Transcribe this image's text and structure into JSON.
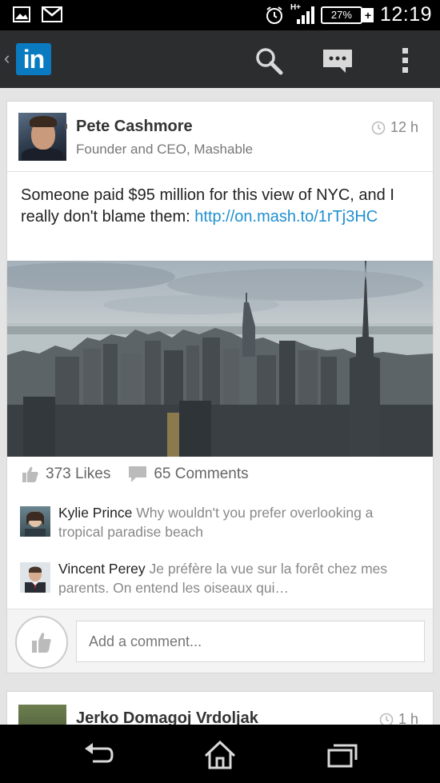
{
  "status_bar": {
    "network": "H+",
    "battery": "27%",
    "battery_charging": "+",
    "time": "12:19"
  },
  "action_bar": {
    "logo_text": "in",
    "icons": [
      "search-icon",
      "messages-icon",
      "overflow-menu-icon"
    ]
  },
  "post": {
    "author_name": "Pete Cashmore",
    "author_title": "Founder and CEO, Mashable",
    "time": "12 h",
    "text_before_link": "Someone paid $95 million for this view of NYC, and I really don't blame them: ",
    "link": "http://on.mash.to/1rTj3HC",
    "likes": "373 Likes",
    "comments_count": "65 Comments",
    "comments": [
      {
        "name": "Kylie Prince",
        "text": "Why wouldn't you prefer overlooking a tropical paradise beach"
      },
      {
        "name": "Vincent Perey",
        "text": "Je préfère la vue sur la forêt chez mes parents. On entend les oiseaux qui…"
      }
    ],
    "add_comment_placeholder": "Add a comment..."
  },
  "next_post": {
    "author_name": "Jerko Domagoj Vrdoljak",
    "time": "1 h"
  },
  "colors": {
    "brand": "#0a7bc1",
    "link": "#1f8fd0",
    "action_bar": "#2c2d2e"
  }
}
